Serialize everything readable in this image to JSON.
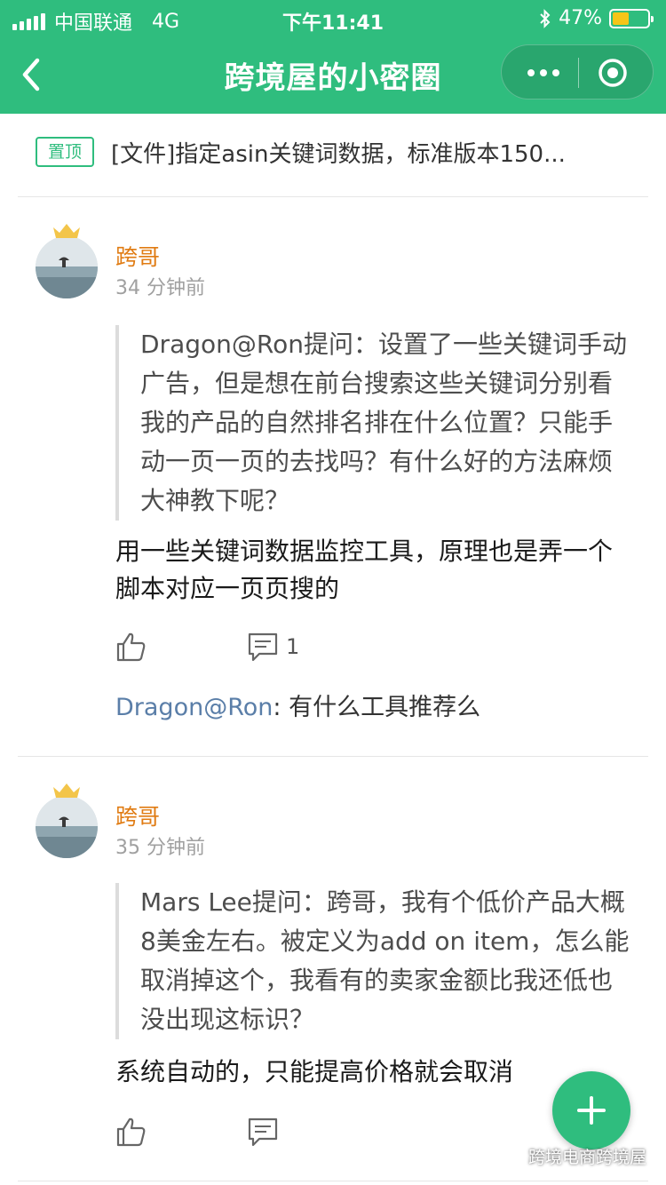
{
  "status_bar": {
    "carrier": "中国联通",
    "network": "4G",
    "time": "下午11:41",
    "battery": "47%",
    "battery_level": 0.47
  },
  "nav": {
    "title": "跨境屋的小密圈",
    "back_icon": "chevron-left-icon",
    "more_icon": "more-dots-icon",
    "close_icon": "target-circle-icon"
  },
  "pinned": {
    "tag": "置顶",
    "text": "[文件]指定asin关键词数据，标准版本150..."
  },
  "posts": [
    {
      "author": "跨哥",
      "time": "34 分钟前",
      "question": "Dragon@Ron提问：设置了一些关键词手动广告，但是想在前台搜索这些关键词分别看我的产品的自然排名排在什么位置？只能手动一页一页的去找吗？有什么好的方法麻烦大神教下呢？",
      "answer": "用一些关键词数据监控工具，原理也是弄一个脚本对应一页页搜的",
      "comment_count": "1",
      "reply": {
        "author": "Dragon@Ron",
        "text": ": 有什么工具推荐么"
      }
    },
    {
      "author": "跨哥",
      "time": "35 分钟前",
      "question": "Mars Lee提问：跨哥，我有个低价产品大概8美金左右。被定义为add on item，怎么能取消掉这个，我看有的卖家金额比我还低也没出现这标识？",
      "answer": "系统自动的，只能提高价格就会取消"
    }
  ],
  "fab": {
    "icon": "plus-icon"
  },
  "watermark": "跨境电商跨境屋",
  "colors": {
    "accent": "#2fbd7e",
    "author": "#e07b12",
    "reply_author": "#5a7ea8"
  }
}
